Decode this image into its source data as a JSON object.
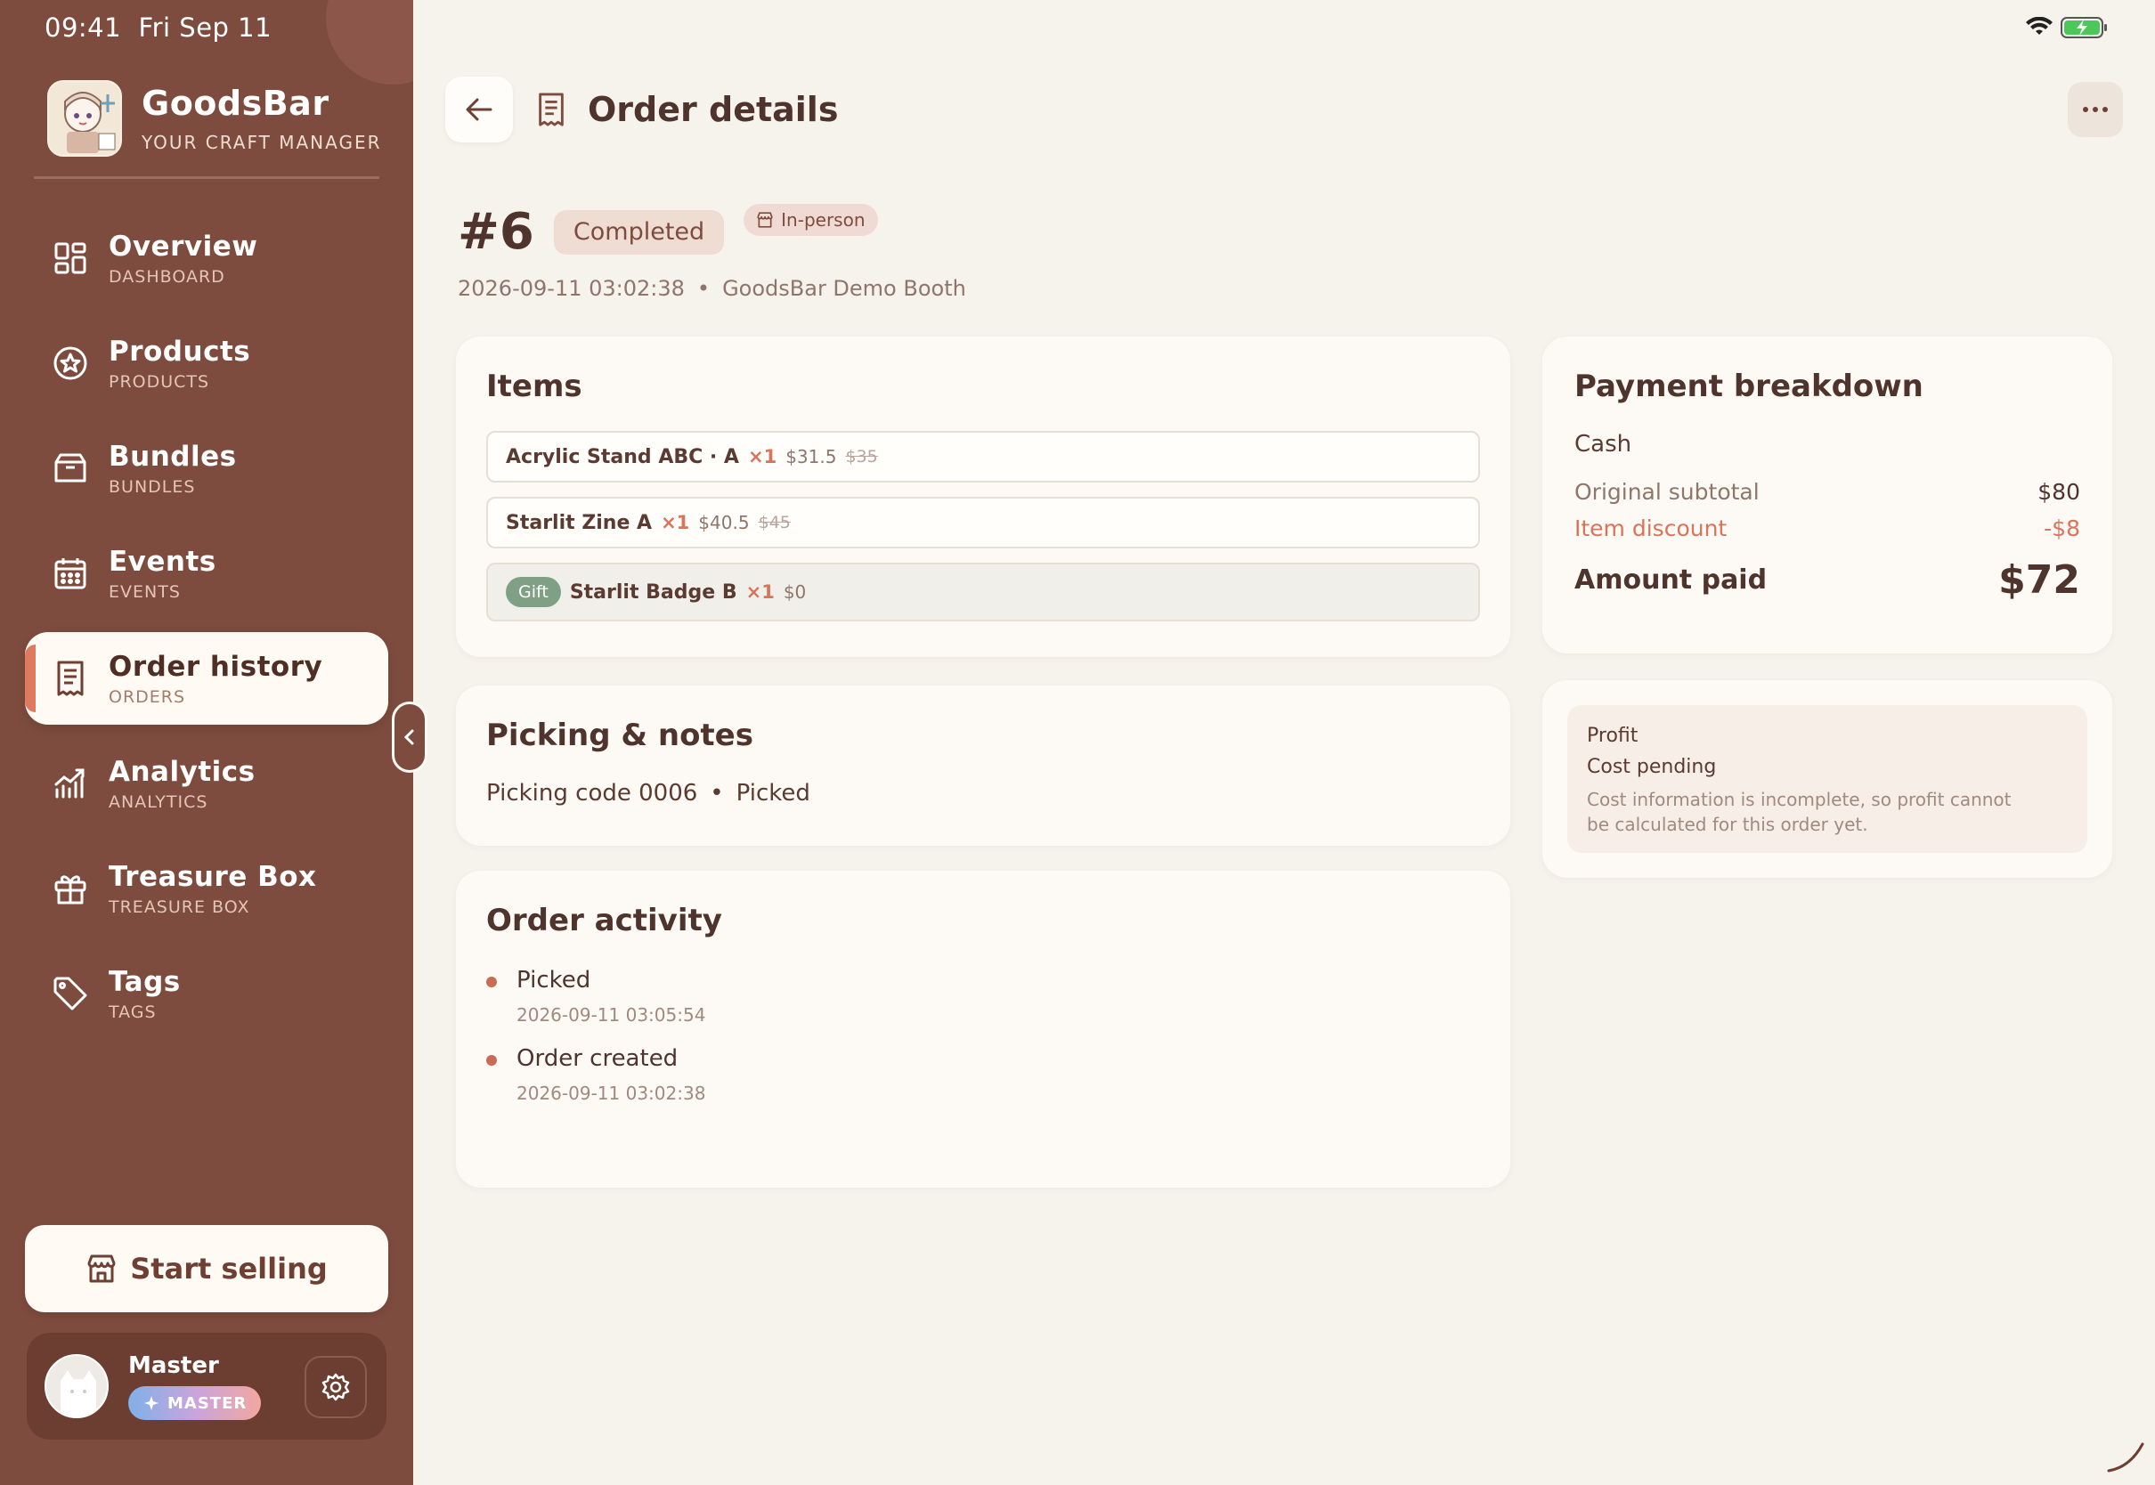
{
  "status_bar": {
    "time": "09:41",
    "date": "Fri Sep 11"
  },
  "brand": {
    "name": "GoodsBar",
    "tagline": "YOUR CRAFT MANAGER"
  },
  "nav": {
    "items": [
      {
        "label": "Overview",
        "sub": "DASHBOARD",
        "icon": "grid-icon"
      },
      {
        "label": "Products",
        "sub": "PRODUCTS",
        "icon": "star-badge-icon"
      },
      {
        "label": "Bundles",
        "sub": "BUNDLES",
        "icon": "box-icon"
      },
      {
        "label": "Events",
        "sub": "EVENTS",
        "icon": "calendar-icon"
      },
      {
        "label": "Order history",
        "sub": "ORDERS",
        "icon": "receipt-icon",
        "active": true
      },
      {
        "label": "Analytics",
        "sub": "ANALYTICS",
        "icon": "chart-icon"
      },
      {
        "label": "Treasure Box",
        "sub": "TREASURE BOX",
        "icon": "gift-icon"
      },
      {
        "label": "Tags",
        "sub": "TAGS",
        "icon": "tag-icon"
      }
    ]
  },
  "start_selling": {
    "label": "Start selling"
  },
  "user": {
    "name": "Master",
    "badge": "MASTER"
  },
  "header": {
    "title": "Order details"
  },
  "order": {
    "number": "#6",
    "status": "Completed",
    "channel": "In-person",
    "datetime": "2026-09-11 03:02:38",
    "sep": "•",
    "location": "GoodsBar Demo Booth"
  },
  "items_card": {
    "title": "Items",
    "items": [
      {
        "name": "Acrylic Stand ABC · A",
        "qty": "×1",
        "price": "$31.5",
        "original": "$35"
      },
      {
        "name": "Starlit Zine A",
        "qty": "×1",
        "price": "$40.5",
        "original": "$45"
      },
      {
        "tag": "Gift",
        "name": "Starlit Badge B",
        "qty": "×1",
        "price": "$0"
      }
    ]
  },
  "picking": {
    "title": "Picking & notes",
    "code": "Picking code 0006",
    "sep": "•",
    "status": "Picked"
  },
  "activity": {
    "title": "Order activity",
    "events": [
      {
        "label": "Picked",
        "time": "2026-09-11 03:05:54"
      },
      {
        "label": "Order created",
        "time": "2026-09-11 03:02:38"
      }
    ]
  },
  "payment": {
    "title": "Payment breakdown",
    "method": "Cash",
    "original_subtotal_label": "Original subtotal",
    "original_subtotal": "$80",
    "discount_label": "Item discount",
    "discount": "-$8",
    "paid_label": "Amount paid",
    "paid": "$72"
  },
  "profit": {
    "title": "Profit",
    "status": "Cost pending",
    "note": "Cost information is incomplete, so profit cannot be calculated for this order yet."
  },
  "colors": {
    "sidebar": "#7d4c3e",
    "accent": "#e07a5f",
    "background": "#f6f2ec",
    "gift": "#7fa085"
  }
}
